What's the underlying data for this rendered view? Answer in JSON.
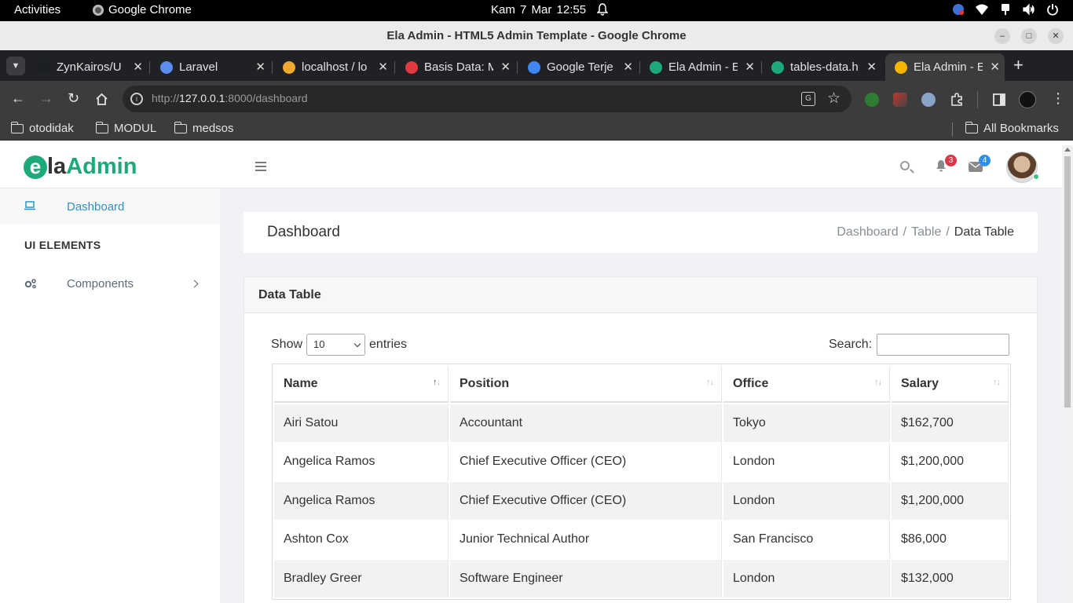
{
  "os": {
    "activities": "Activities",
    "app_name": "Google Chrome",
    "clock": "Kam  7 Mar  12:55"
  },
  "window": {
    "title": "Ela Admin - HTML5 Admin Template - Google Chrome"
  },
  "tabs": [
    {
      "label": "ZynKairos/U",
      "color": "#1b1f23"
    },
    {
      "label": "Laravel",
      "color": "#5b8def"
    },
    {
      "label": "localhost / lo",
      "color": "#f0a830"
    },
    {
      "label": "Basis Data: M",
      "color": "#e0393e"
    },
    {
      "label": "Google Terje",
      "color": "#4285f4"
    },
    {
      "label": "Ela Admin - E",
      "color": "#1ea97c"
    },
    {
      "label": "tables-data.h",
      "color": "#1ea97c"
    },
    {
      "label": "Ela Admin - E",
      "color": "#f4b400"
    }
  ],
  "omnibox": {
    "scheme": "http://",
    "host": "127.0.0.1",
    "rest": ":8000/dashboard"
  },
  "bookmarks": {
    "items": [
      "otodidak",
      "MODUL",
      "medsos"
    ],
    "all": "All Bookmarks"
  },
  "header": {
    "logo_e": "e",
    "logo_la": "la",
    "logo_admin": "Admin",
    "notif_count": "3",
    "mail_count": "4"
  },
  "sidebar": {
    "dashboard": "Dashboard",
    "section": "UI ELEMENTS",
    "components": "Components"
  },
  "breadcrumb": {
    "page_title": "Dashboard",
    "items": [
      "Dashboard",
      "Table",
      "Data Table"
    ]
  },
  "card": {
    "title": "Data Table",
    "show_label": "Show",
    "entries_value": "10",
    "entries_label": "entries",
    "search_label": "Search:"
  },
  "table": {
    "columns": [
      "Name",
      "Position",
      "Office",
      "Salary"
    ],
    "rows": [
      [
        "Airi Satou",
        "Accountant",
        "Tokyo",
        "$162,700"
      ],
      [
        "Angelica Ramos",
        "Chief Executive Officer (CEO)",
        "London",
        "$1,200,000"
      ],
      [
        "Angelica Ramos",
        "Chief Executive Officer (CEO)",
        "London",
        "$1,200,000"
      ],
      [
        "Ashton Cox",
        "Junior Technical Author",
        "San Francisco",
        "$86,000"
      ],
      [
        "Bradley Greer",
        "Software Engineer",
        "London",
        "$132,000"
      ]
    ]
  }
}
